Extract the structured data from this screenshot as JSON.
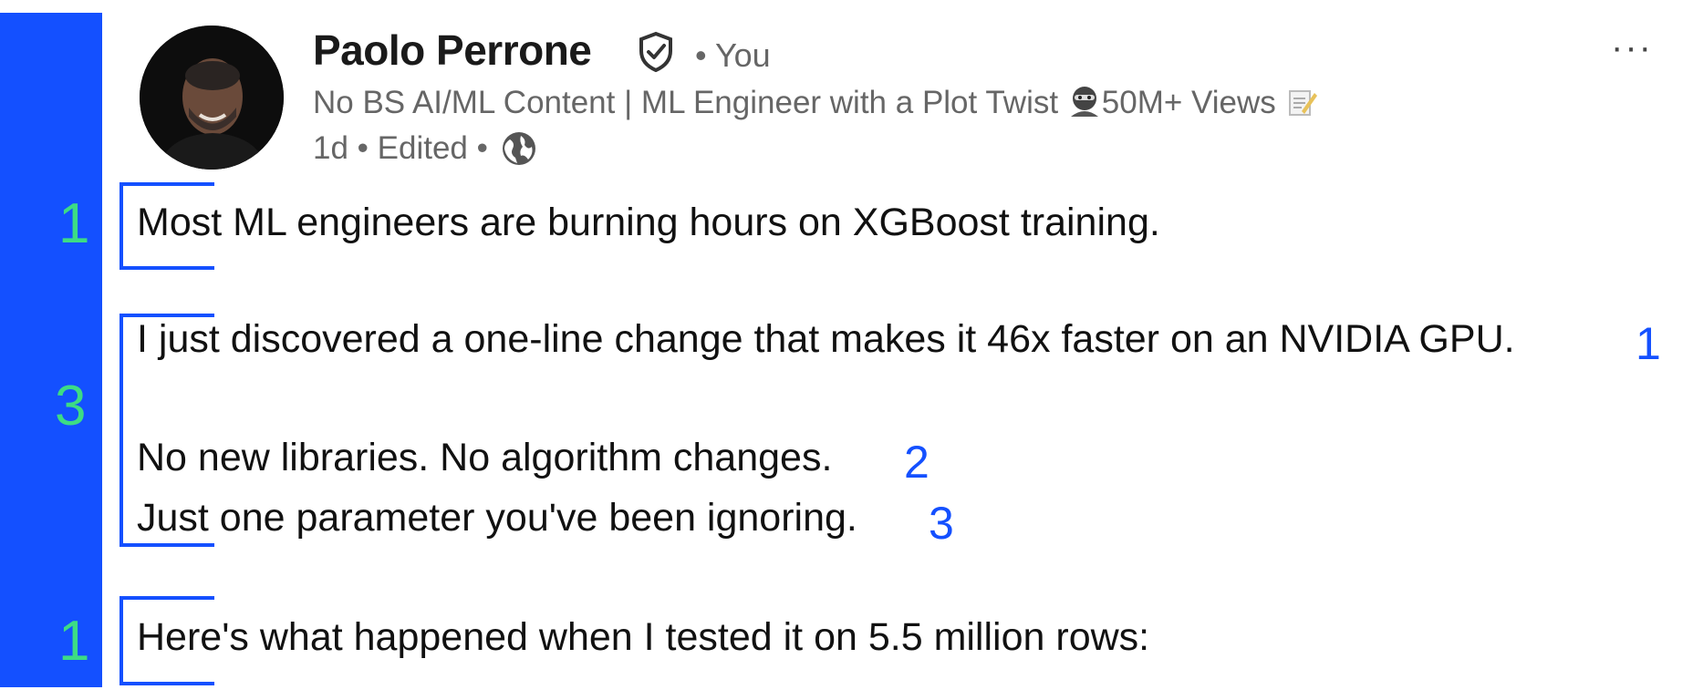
{
  "post": {
    "author_name": "Paolo Perrone",
    "relation": "• You",
    "headline_text": "No BS AI/ML Content | ML Engineer with a Plot Twist ",
    "headline_emoji_1": "ninja-emoji",
    "headline_views": "50M+ Views ",
    "headline_emoji_2": "memo-emoji",
    "meta": "1d • Edited •",
    "menu_label": "···"
  },
  "lines": [
    "Most ML engineers are burning hours on XGBoost training.",
    "I just discovered a one-line change that makes it 46x faster on an NVIDIA GPU.",
    "No new libraries. No algorithm changes.",
    "Just one parameter you've been ignoring.",
    "Here's what happened when I tested it on 5.5 million rows:"
  ],
  "annotations": {
    "group_counts": [
      "1",
      "3",
      "1"
    ],
    "line_numbers": [
      "1",
      "2",
      "3"
    ]
  },
  "colors": {
    "accent_blue": "#1450ff",
    "count_green": "#3ddc84",
    "muted_text": "#666666"
  },
  "icons": [
    "verified-icon",
    "globe-icon",
    "more-options-icon"
  ]
}
